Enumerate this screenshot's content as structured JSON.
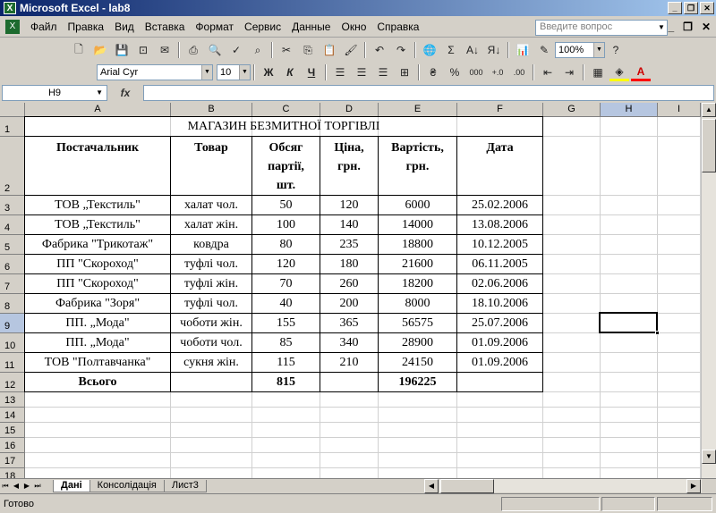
{
  "window": {
    "title": "Microsoft Excel - lab8"
  },
  "menu": [
    "Файл",
    "Правка",
    "Вид",
    "Вставка",
    "Формат",
    "Сервис",
    "Данные",
    "Окно",
    "Справка"
  ],
  "help_placeholder": "Введите вопрос",
  "toolbar": {
    "zoom": "100%",
    "font": "Arial Cyr",
    "size": "10",
    "bold": "Ж",
    "italic": "К",
    "underline": "Ч",
    "percent": "%",
    "thousands": "000"
  },
  "formula_bar": {
    "cell_ref": "H9",
    "fx": "fx",
    "value": ""
  },
  "columns": [
    "A",
    "B",
    "C",
    "D",
    "E",
    "F",
    "G",
    "H",
    "I"
  ],
  "rows": [
    "1",
    "2",
    "3",
    "4",
    "5",
    "6",
    "7",
    "8",
    "9",
    "10",
    "11",
    "12",
    "13",
    "14",
    "15",
    "16",
    "17",
    "18"
  ],
  "sheet": {
    "title": "МАГАЗИН БЕЗМИТНОЇ ТОРГІВЛІ",
    "headers": [
      "Постачальник",
      "Товар",
      "Обсяг партії, шт.",
      "Ціна, грн.",
      "Вартість, грн.",
      "Дата"
    ],
    "header_lines": [
      [
        "Постачальник"
      ],
      [
        "Товар"
      ],
      [
        "Обсяг",
        "партії,",
        "шт."
      ],
      [
        "Ціна,",
        "грн."
      ],
      [
        "Вартість,",
        "грн."
      ],
      [
        "Дата"
      ]
    ],
    "data": [
      [
        "ТОВ „Текстиль\"",
        "халат чол.",
        "50",
        "120",
        "6000",
        "25.02.2006"
      ],
      [
        "ТОВ „Текстиль\"",
        "халат жін.",
        "100",
        "140",
        "14000",
        "13.08.2006"
      ],
      [
        "Фабрика \"Трикотаж\"",
        "ковдра",
        "80",
        "235",
        "18800",
        "10.12.2005"
      ],
      [
        "ПП \"Скороход\"",
        "туфлі чол.",
        "120",
        "180",
        "21600",
        "06.11.2005"
      ],
      [
        "ПП \"Скороход\"",
        "туфлі жін.",
        "70",
        "260",
        "18200",
        "02.06.2006"
      ],
      [
        "Фабрика \"Зоря\"",
        "туфлі чол.",
        "40",
        "200",
        "8000",
        "18.10.2006"
      ],
      [
        "ПП. „Мода\"",
        "чоботи жін.",
        "155",
        "365",
        "56575",
        "25.07.2006"
      ],
      [
        "ПП. „Мода\"",
        "чоботи чол.",
        "85",
        "340",
        "28900",
        "01.09.2006"
      ],
      [
        "ТОВ \"Полтавчанка\"",
        "сукня жін.",
        "115",
        "210",
        "24150",
        "01.09.2006"
      ]
    ],
    "total": [
      "Всього",
      "",
      "815",
      "",
      "196225",
      ""
    ]
  },
  "tabs": [
    "Дані",
    "Консолідація",
    "Лист3"
  ],
  "status": "Готово"
}
